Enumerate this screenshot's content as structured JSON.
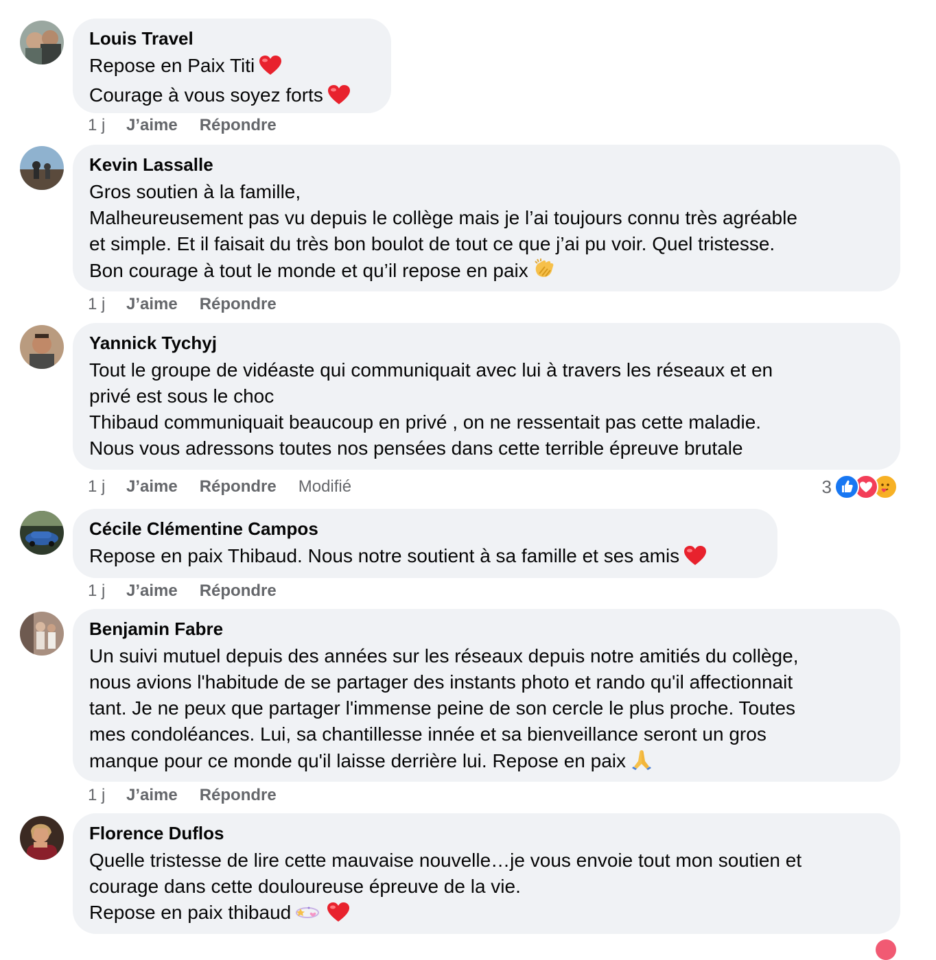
{
  "actions": {
    "time": "1 j",
    "like": "J’aime",
    "reply": "Répondre",
    "edited": "Modifié"
  },
  "colors": {
    "bubble": "#f0f2f5",
    "muted_text": "#65676b",
    "like_blue": "#1877f2",
    "heart_red": "#f33e58",
    "care_yellow": "#f7b125"
  },
  "comments": [
    {
      "author": "Louis Travel",
      "lines": [
        "Repose en Paix Titi",
        "Courage à vous soyez forts"
      ],
      "line_emojis": [
        "heart-emoji",
        "heart-emoji"
      ],
      "avatar": "user-photo-avatar"
    },
    {
      "author": "Kevin Lassalle",
      "lines": [
        "Gros soutien à la famille,",
        "Malheureusement pas vu depuis le collège mais je l’ai toujours connu très agréable",
        "et simple. Et il faisait du très bon boulot de tout ce que j’ai pu voir. Quel tristesse.",
        "Bon courage à tout le monde et qu’il repose en paix"
      ],
      "line_emojis": [
        "",
        "",
        "",
        "clapping-hands-emoji"
      ],
      "avatar": "user-photo-avatar"
    },
    {
      "author": "Yannick Tychyj",
      "lines": [
        "Tout le groupe de vidéaste qui communiquait avec lui à travers les réseaux et en",
        "privé est sous le choc",
        "Thibaud communiquait beaucoup en privé , on ne ressentait pas cette maladie.",
        "Nous vous adressons toutes nos pensées dans cette terrible épreuve brutale"
      ],
      "line_emojis": [
        "",
        "",
        "",
        ""
      ],
      "avatar": "user-photo-avatar",
      "edited": true,
      "reactions": {
        "count": "3",
        "types": [
          "like-reaction-icon",
          "love-reaction-icon",
          "care-reaction-icon"
        ]
      }
    },
    {
      "author": "Cécile Clémentine Campos",
      "lines": [
        "Repose en paix Thibaud. Nous notre soutient à sa famille et ses amis"
      ],
      "line_emojis": [
        "heart-emoji"
      ],
      "avatar": "user-photo-avatar"
    },
    {
      "author": "Benjamin Fabre",
      "lines": [
        "Un suivi mutuel depuis des années sur les réseaux depuis notre amitiés du collège,",
        "nous avions l'habitude de se partager des instants photo et rando qu'il affectionnait",
        "tant. Je ne peux que partager l'immense peine de son cercle le plus proche. Toutes",
        "mes condoléances. Lui, sa chantillesse innée et sa bienveillance seront un gros",
        "manque pour ce monde qu'il laisse derrière lui. Repose en paix"
      ],
      "line_emojis": [
        "",
        "",
        "",
        "",
        "folded-hands-emoji"
      ],
      "avatar": "user-photo-avatar"
    },
    {
      "author": "Florence Duflos",
      "lines": [
        "Quelle tristesse de lire cette mauvaise nouvelle…je vous envoie tout mon soutien et",
        "courage dans cette douloureuse épreuve de la vie.",
        "Repose en paix thibaud"
      ],
      "line_emojis": [
        "",
        "",
        "dizzy-star-and-heart-emoji"
      ],
      "avatar": "user-photo-avatar"
    }
  ]
}
